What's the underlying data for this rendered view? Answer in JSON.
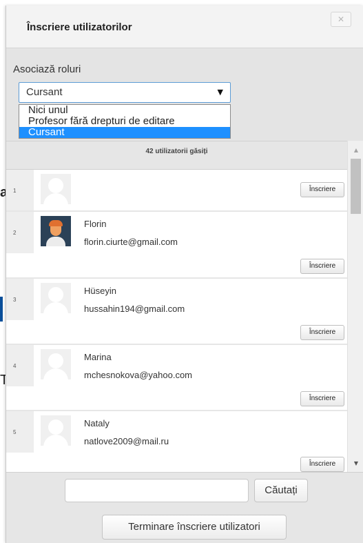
{
  "background": {
    "fragment_1": "a",
    "fragment_2": "T"
  },
  "dialog": {
    "title": "Înscriere utilizatorilor",
    "close_label": "✕"
  },
  "roles": {
    "label": "Asociază roluri",
    "selected": "Cursant",
    "options": [
      "Nici unul",
      "Profesor fără drepturi de editare",
      "Cursant"
    ]
  },
  "results": {
    "count_label": "42 utilizatorii găsiți"
  },
  "users": [
    {
      "num": "1",
      "name": "",
      "email": "",
      "avatar": "default",
      "button": "Înscriere"
    },
    {
      "num": "2",
      "name": "Florin",
      "email": "florin.ciurte@gmail.com",
      "avatar": "photo",
      "button": "Înscriere"
    },
    {
      "num": "3",
      "name": "Hüseyin",
      "email": "hussahin194@gmail.com",
      "avatar": "default",
      "button": "Înscriere"
    },
    {
      "num": "4",
      "name": "Marina",
      "email": "mchesnokova@yahoo.com",
      "avatar": "default",
      "button": "Înscriere"
    },
    {
      "num": "5",
      "name": "Nataly",
      "email": "natlove2009@mail.ru",
      "avatar": "default",
      "button": "Înscriere"
    }
  ],
  "search": {
    "value": "",
    "placeholder": "",
    "button_label": "Căutați"
  },
  "footer": {
    "finish_label": "Terminare înscriere utilizatori"
  },
  "colors": {
    "accent": "#1e90ff",
    "select_border": "#5b9bd5",
    "dialog_bg": "#e6e6e6"
  }
}
